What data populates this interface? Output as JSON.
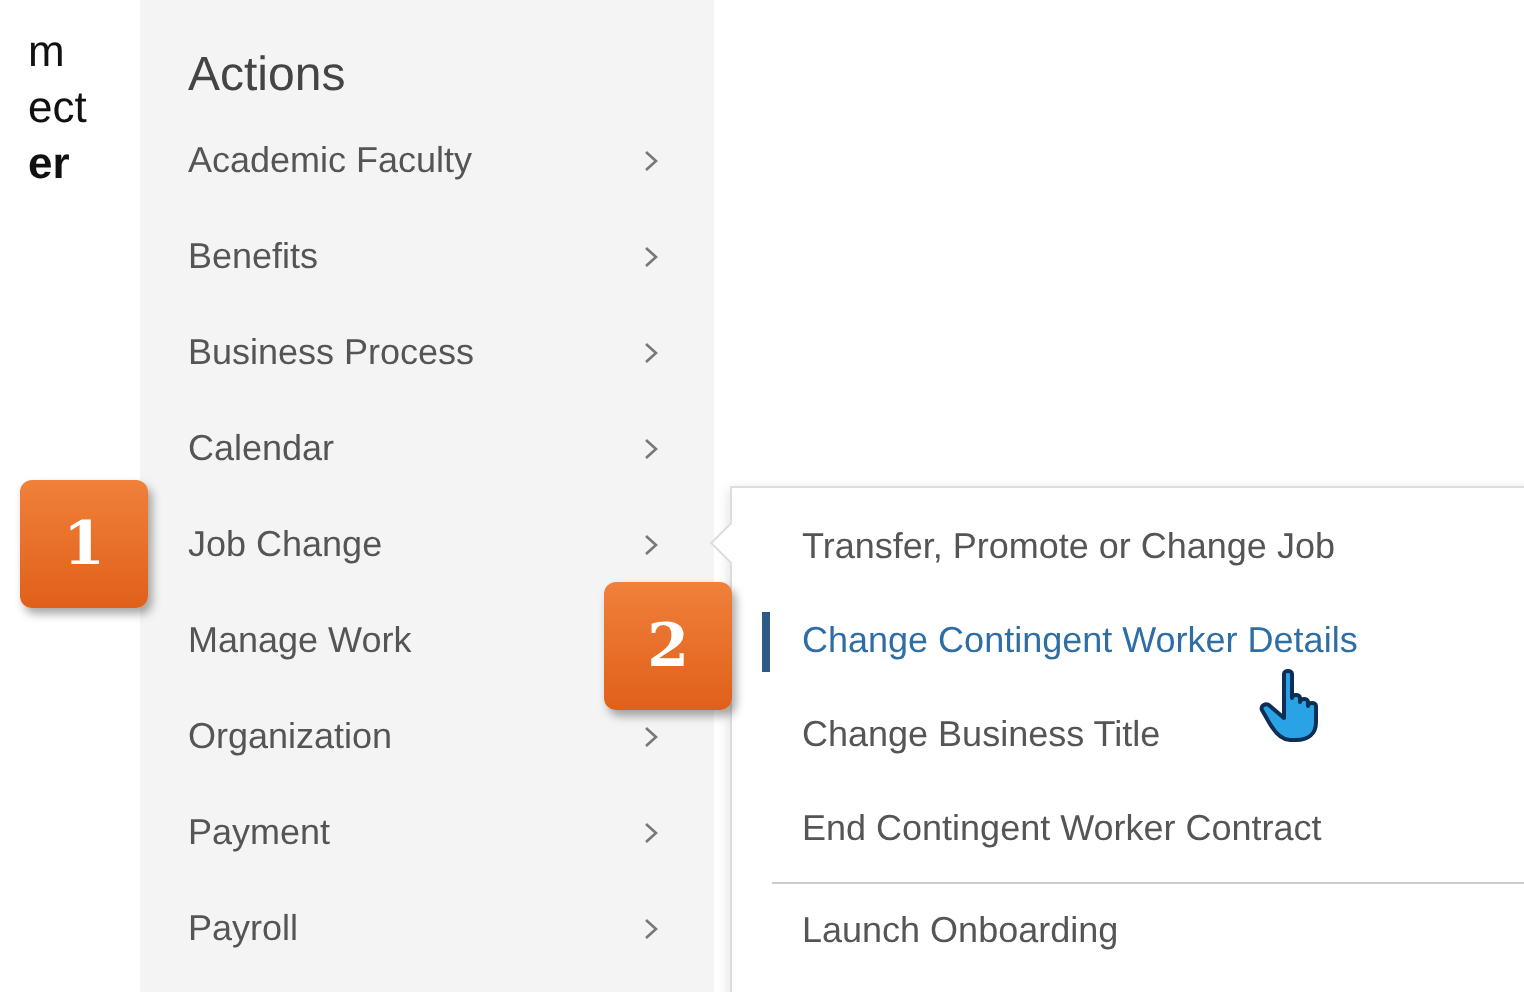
{
  "side_text": [
    {
      "text": "m",
      "bold": false
    },
    {
      "text": "ect",
      "bold": false
    },
    {
      "text": "er",
      "bold": true
    }
  ],
  "menu": {
    "title": "Actions",
    "items": [
      {
        "label": "Academic Faculty",
        "has_submenu": true
      },
      {
        "label": "Benefits",
        "has_submenu": true
      },
      {
        "label": "Business Process",
        "has_submenu": true
      },
      {
        "label": "Calendar",
        "has_submenu": true
      },
      {
        "label": "Job Change",
        "has_submenu": true,
        "badge": "1"
      },
      {
        "label": "Manage Work",
        "has_submenu": false
      },
      {
        "label": "Organization",
        "has_submenu": true
      },
      {
        "label": "Payment",
        "has_submenu": true
      },
      {
        "label": "Payroll",
        "has_submenu": true
      }
    ]
  },
  "submenu": {
    "items": [
      {
        "label": "Transfer, Promote or Change Job",
        "selected": false
      },
      {
        "label": "Change Contingent Worker Details",
        "selected": true,
        "badge": "2"
      },
      {
        "label": "Change Business Title",
        "selected": false
      },
      {
        "label": "End Contingent Worker Contract",
        "selected": false
      },
      {
        "label": "Launch Onboarding",
        "selected": false,
        "divider_above": true
      }
    ]
  }
}
